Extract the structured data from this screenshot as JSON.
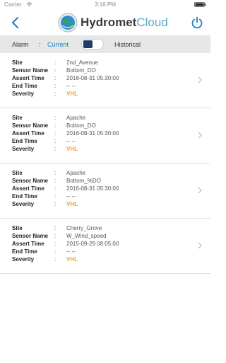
{
  "status_bar": {
    "carrier": "Carrier",
    "time": "3:16 PM"
  },
  "header": {
    "logo_bold": "Hydromet",
    "logo_light": "Cloud"
  },
  "alarm_bar": {
    "label": "Alarm",
    "separator": ":",
    "current": "Current",
    "historical": "Historical"
  },
  "field_labels": {
    "site": "Site",
    "sensor_name": "Sensor Name",
    "assert_time": "Assert Time",
    "end_time": "End Time",
    "severity": "Severity",
    "separator": ":"
  },
  "alarms": [
    {
      "site": "2nd_Avenue",
      "sensor_name": "Bottom_DO",
      "assert_time": "2016-08-31 05:30:00",
      "end_time": "-- --",
      "severity": "VHL"
    },
    {
      "site": "Apache",
      "sensor_name": "Bottom_DO",
      "assert_time": "2016-08-31 05:30:00",
      "end_time": "-- --",
      "severity": "VHL"
    },
    {
      "site": "Apache",
      "sensor_name": "Bottom_%DO",
      "assert_time": "2016-08-31 05:30:00",
      "end_time": "-- --",
      "severity": "VHL"
    },
    {
      "site": "Cherry_Grove",
      "sensor_name": "W_Wind_speed",
      "assert_time": "2015-09-29 08:05:00",
      "end_time": "-- --",
      "severity": "VHL"
    }
  ],
  "colors": {
    "accent": "#1a80c4",
    "severity": "#e8a33c",
    "toggle_knob": "#1e3d66",
    "bar_background": "#e7e7e7"
  }
}
